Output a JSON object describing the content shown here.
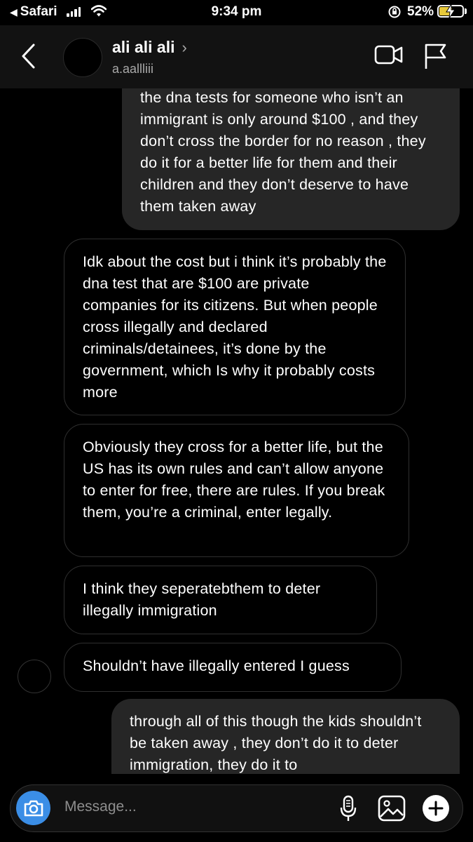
{
  "status_bar": {
    "back_app": "Safari",
    "time": "9:34 pm",
    "battery_percent": "52%",
    "battery_level": 0.52,
    "battery_color": "#e7c93a"
  },
  "header": {
    "name": "ali ali ali",
    "handle": "a.aallliii"
  },
  "messages": [
    {
      "direction": "outgoing",
      "text": "the dna tests for someone who isn’t an immigrant is only around $100 , and they don’t cross the border for no reason , they do it for a better life for them and their children and they don’t deserve to have them taken away"
    },
    {
      "direction": "incoming",
      "text": "Idk about the cost but i think it’s probably the dna test that are $100 are private companies for its citizens. But when people cross illegally and declared criminals/detainees, it’s done by the government, which Is why it probably costs more"
    },
    {
      "direction": "incoming",
      "text": "Obviously they cross for a better life, but the US has its own rules and can’t allow anyone to enter for free, there are rules. If you break them, you’re a criminal, enter legally."
    },
    {
      "direction": "incoming",
      "text": "I think they seperatebthem to deter illegally immigration"
    },
    {
      "direction": "incoming",
      "text": "Shouldn’t have illegally entered I guess"
    },
    {
      "direction": "outgoing",
      "text": "through all of this though the kids shouldn’t be taken away , they don’t do it to deter immigration, they do it to"
    }
  ],
  "composer": {
    "placeholder": "Message..."
  },
  "colors": {
    "outgoing_bubble": "#262626",
    "camera_button": "#3b8ee6"
  }
}
